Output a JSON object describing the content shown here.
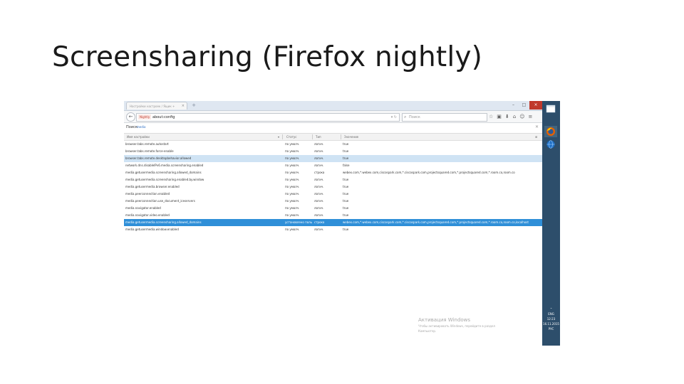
{
  "slide": {
    "title": "Screensharing (Firefox nightly)"
  },
  "browser": {
    "tab_title": "Настройки настроек / Ящик +",
    "new_tab": "+",
    "window_controls": [
      "–",
      "□",
      "×"
    ],
    "url_identity": "Nightly",
    "url": "about:config",
    "search_placeholder": "Поиск",
    "toolbar_icons": [
      "☆",
      "▣",
      "⬇",
      "⌂",
      "☺",
      "≡"
    ],
    "find_label": "Поиск:",
    "find_value": "media",
    "clear_symbol": "✕"
  },
  "config_table": {
    "columns": [
      "Имя настройки",
      "Статус",
      "Тип",
      "Значение"
    ],
    "rows": [
      {
        "name": "browser.tabs.remote.autostart",
        "status": "по умолч.",
        "type": "логич.",
        "value": "true"
      },
      {
        "name": "browser.tabs.remote.force-enable",
        "status": "по умолч.",
        "type": "логич.",
        "value": "true"
      },
      {
        "name": "browser.tabs.remote.desktopbehavior.allowed",
        "status": "по умолч.",
        "type": "логич.",
        "value": "true"
      },
      {
        "name": "network.dns.disableIPv6.media.screensharing.enabled",
        "status": "по умолч.",
        "type": "логич.",
        "value": "false"
      },
      {
        "name": "media.getusermedia.screensharing.allowed_domains",
        "status": "по умолч.",
        "type": "строка",
        "value": "webex.com,*.webex.com,ciscospark.com,*.ciscospark.com,projectsquared.com,*.projectsquared.com,*.room.co,room.co"
      },
      {
        "name": "media.getusermedia.screensharing.enabled.by.window",
        "status": "по умолч.",
        "type": "логич.",
        "value": "true"
      },
      {
        "name": "media.getusermedia.browser.enabled",
        "status": "по умолч.",
        "type": "логич.",
        "value": "true"
      },
      {
        "name": "media.peerconnection.enabled",
        "status": "по умолч.",
        "type": "логич.",
        "value": "true"
      },
      {
        "name": "media.peerconnection.use_document_iceservers",
        "status": "по умолч.",
        "type": "логич.",
        "value": "true"
      },
      {
        "name": "media.navigator.enabled",
        "status": "по умолч.",
        "type": "логич.",
        "value": "true"
      },
      {
        "name": "media.navigator.video.enabled",
        "status": "по умолч.",
        "type": "логич.",
        "value": "true"
      },
      {
        "name": "media.getusermedia.screensharing.allowed_domains",
        "status": "установлено польз.",
        "type": "строка",
        "value": "webex.com,*.webex.com,ciscospark.com,*.ciscospark.com,projectsquared.com,*.projectsquared.com,*.room.co,room.co,localhost"
      },
      {
        "name": "media.getusermedia.window.enabled",
        "status": "по умолч.",
        "type": "логич.",
        "value": "true"
      }
    ]
  },
  "watermark": {
    "title": "Активация Windows",
    "line1": "Чтобы активировать Windows, перейдите в раздел",
    "line2": "Компьютер."
  },
  "taskbar": {
    "clock_lines": [
      "ENG",
      "12:23",
      "16.11.2015"
    ],
    "lang": "РУС"
  }
}
